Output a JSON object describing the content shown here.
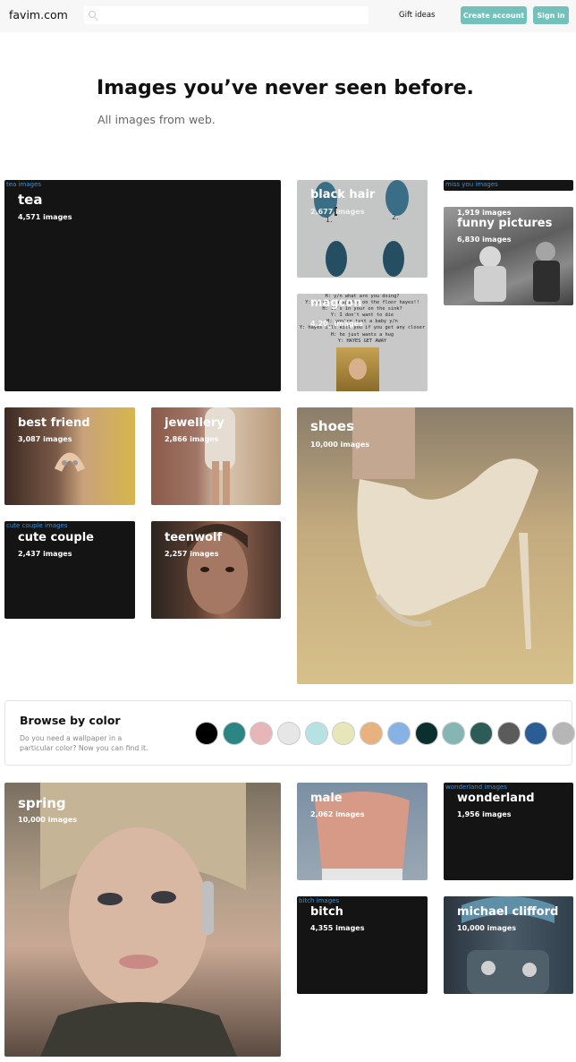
{
  "header": {
    "logo": "favim.com",
    "search_placeholder": "",
    "gift_label": "Gift ideas",
    "create_label": "Create account",
    "signin_label": "Sign in"
  },
  "hero": {
    "title": "Images you’ve never seen before.",
    "subtitle": "All images from web."
  },
  "tiles": {
    "tea": {
      "tag": "tea images",
      "title": "tea",
      "count": "4,571 images"
    },
    "black_hair": {
      "title": "black hair",
      "count": "2,677 images"
    },
    "miss_you": {
      "tag": "miss you images"
    },
    "funny": {
      "tag_count": "1,919 images",
      "title": "funny pictures",
      "count": "6,830 images"
    },
    "magcon": {
      "title": "magcon",
      "count": "4,20_ images",
      "lines": [
        "H: y/n what are you doing?",
        "Y: there's a spider on the floor hayes!!",
        "H: it's in your on the sink?",
        "Y: I don't want to die",
        "H: you're just a baby y/n",
        "Y: hayes I'll kill you if you get any closer",
        "H: he just wants a hug",
        "Y: HAYES GET AWAY"
      ]
    },
    "best_friend": {
      "title": "best friend",
      "count": "3,087 images"
    },
    "jewellery": {
      "title": "jewellery",
      "count": "2,866 images"
    },
    "shoes": {
      "title": "shoes",
      "count": "10,000 images"
    },
    "cute_couple": {
      "tag": "cute couple images",
      "title": "cute couple",
      "count": "2,437 images"
    },
    "teenwolf": {
      "title": "teenwolf",
      "count": "2,257 images"
    },
    "spring": {
      "title": "spring",
      "count": "10,000 images"
    },
    "male": {
      "title": "male",
      "count": "2,062 images"
    },
    "wonderland": {
      "tag": "wonderland images",
      "title": "wonderland",
      "count": "1,956 images"
    },
    "bitch": {
      "tag": "bitch images",
      "title": "bitch",
      "count": "4,355 images"
    },
    "michael": {
      "title": "michael clifford",
      "count": "10,000 images"
    }
  },
  "browse": {
    "title": "Browse by color",
    "description": "Do you need a wallpaper in a particular color? Now you can find it.",
    "swatches": [
      "#000000",
      "#2b8585",
      "#e6b6b8",
      "#e6e6e6",
      "#b6e2e4",
      "#e6e6b8",
      "#e8b27f",
      "#86b2e6",
      "#0b2f2c",
      "#86b6b4",
      "#2d5c58",
      "#5b5b5b",
      "#2a5c96",
      "#b6b6b6"
    ]
  },
  "colors": {
    "accent": "#72c1bb",
    "tag_text": "#3d8fd6",
    "tile_dark": "#141414"
  }
}
